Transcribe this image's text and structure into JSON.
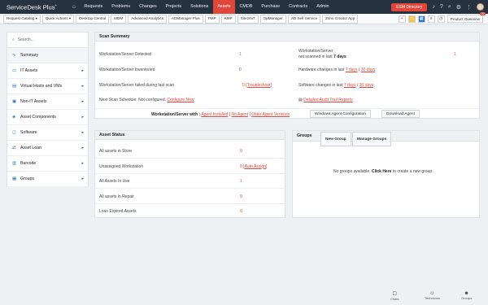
{
  "app": {
    "brand": "ServiceDesk Plus",
    "brand_mark": "+"
  },
  "nav": [
    "Requests",
    "Problems",
    "Changes",
    "Projects",
    "Solutions",
    "Assets",
    "CMDB",
    "Purchase",
    "Contracts",
    "Admin"
  ],
  "nav_active": "Assets",
  "top_right": {
    "esm_label": "ESM Directory"
  },
  "toolbar": {
    "items": [
      "Request Catalog ▾",
      "Quick Actions ▾",
      "Desktop Central",
      "MDM",
      "Advanced Analytics",
      "ADManager Plus",
      "PMP",
      "KMP",
      "Site24x7",
      "OpManager",
      "AD Self Service",
      "Zoho Creator App"
    ],
    "product_overview": "Product Overview",
    "badge": "29"
  },
  "sidebar": {
    "search_placeholder": "Search...",
    "items": [
      {
        "label": "Summary",
        "icon": "chart-icon",
        "has_chevron": false
      },
      {
        "label": "IT Assets",
        "icon": "desktop-icon",
        "has_chevron": true
      },
      {
        "label": "Virtual Hosts and VMs",
        "icon": "server-icon",
        "has_chevron": true
      },
      {
        "label": "Non-IT Assets",
        "icon": "box-icon",
        "has_chevron": true
      },
      {
        "label": "Asset Components",
        "icon": "component-icon",
        "has_chevron": true
      },
      {
        "label": "Software",
        "icon": "software-icon",
        "has_chevron": true
      },
      {
        "label": "Asset Loan",
        "icon": "loan-icon",
        "has_chevron": true
      },
      {
        "label": "Barcode",
        "icon": "barcode-icon",
        "has_chevron": true
      },
      {
        "label": "Groups",
        "icon": "groups-icon",
        "has_chevron": true
      }
    ]
  },
  "scan_summary": {
    "title": "Scan Summary",
    "detected_label": "Workstation/Server Detected",
    "detected_value": "1",
    "inventoried_label": "Workstation/Server Inventoried",
    "inventoried_value": "0",
    "failed_label": "Workstation/Server failed during last scan.",
    "failed_value": "0",
    "troubleshoot": "Troubleshoot",
    "next_scan_label": "Next Scan Schedule: Not configured",
    "configure_now": "Configure Now",
    "not_scanned_label": "Workstation/Server",
    "not_scanned_sub": "not scanned in last",
    "not_scanned_days": "7 days",
    "not_scanned_value": "1",
    "hardware_label": "Hardware changes in last",
    "software_label": "Software changes in last",
    "days_7": "7 days",
    "days_30": "30 days",
    "audit_link": "Detailed Audit Trail Reports",
    "agent_label": "Workstation/Server with :",
    "agent_installed": "Agent Installed",
    "no_agent": "No Agent",
    "older_agent": "Older Agent Versions",
    "agent_config_btn": "Windows Agent Configuration",
    "download_agent_btn": "Download Agent"
  },
  "asset_status": {
    "title": "Asset Status",
    "rows": [
      {
        "label": "All assets in Store",
        "value": "0",
        "extra": ""
      },
      {
        "label": "Unassigned Workstation",
        "value": "0",
        "extra": "Auto Assign"
      },
      {
        "label": "All Assets In Use",
        "value": "1",
        "extra": ""
      },
      {
        "label": "All assets in Repair",
        "value": "0",
        "extra": ""
      },
      {
        "label": "Loan Expired Assets",
        "value": "0",
        "extra": ""
      }
    ]
  },
  "groups": {
    "title": "Groups",
    "new_group": "New Group",
    "manage_groups": "Manage Groups",
    "empty_prefix": "No groups available.",
    "click_here": "Click Here",
    "empty_suffix": "to create a new group."
  },
  "bottom_bar": [
    {
      "label": "Chats",
      "icon": "chat-icon"
    },
    {
      "label": "Technician",
      "icon": "technician-icon"
    },
    {
      "label": "Groups",
      "icon": "groups-icon"
    }
  ]
}
